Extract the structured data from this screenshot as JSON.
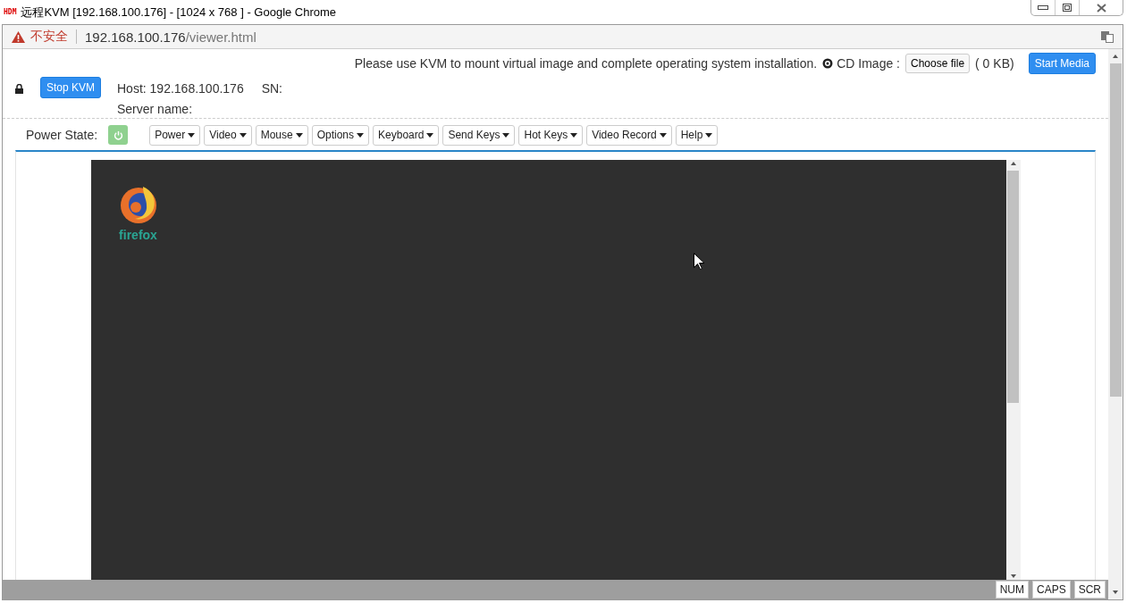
{
  "window": {
    "badge": "HDM",
    "title": "远程KVM [192.168.100.176] - [1024 x 768 ] - Google Chrome"
  },
  "address_bar": {
    "security": "不安全",
    "url_host": "192.168.100.176",
    "url_path": "/viewer.html"
  },
  "header": {
    "stop_button": "Stop KVM",
    "host": "Host: 192.168.100.176",
    "sn": "SN:",
    "server_name": "Server name:",
    "notice": "Please use KVM to mount virtual image and complete operating system installation.",
    "cd_label": "CD Image :",
    "choose_file": "Choose file",
    "size": "( 0 KB)",
    "start_button": "Start Media"
  },
  "toolbar": {
    "power_label": "Power State:",
    "power_on": true,
    "menus": [
      "Power",
      "Video",
      "Mouse",
      "Options",
      "Keyboard",
      "Send Keys",
      "Hot Keys",
      "Video Record",
      "Help"
    ]
  },
  "remote_screen": {
    "desktop_icons": [
      {
        "label": "firefox"
      }
    ]
  },
  "status_bar": {
    "keys": [
      "NUM",
      "CAPS",
      "SCR"
    ]
  }
}
